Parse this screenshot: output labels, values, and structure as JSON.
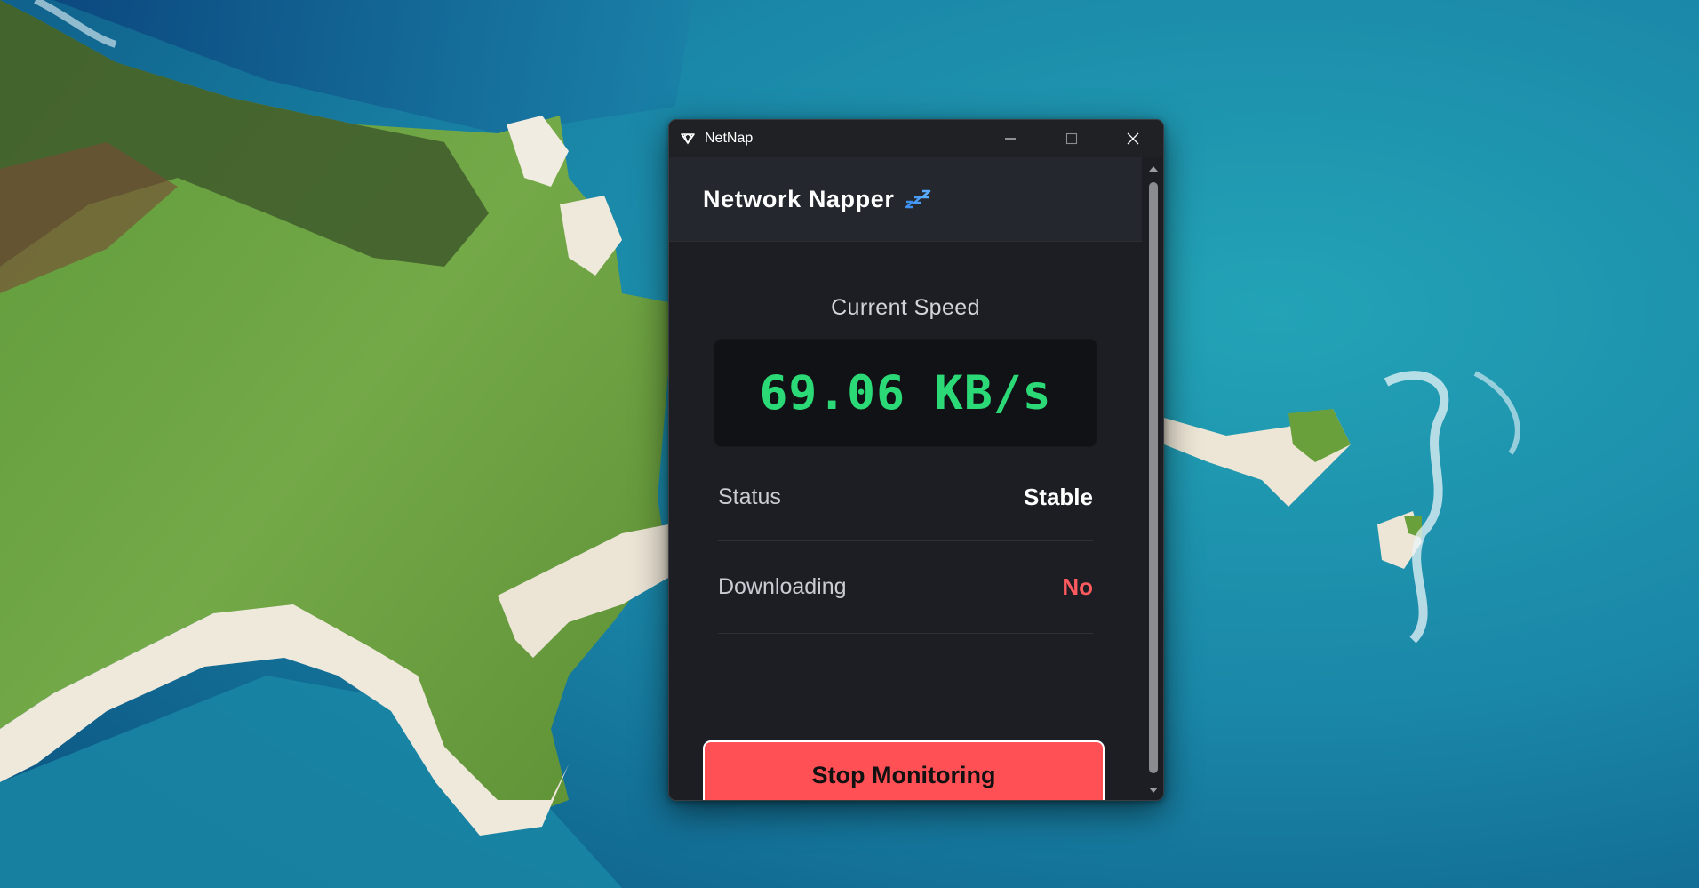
{
  "window": {
    "title": "NetNap"
  },
  "app": {
    "header_title": "Network Napper",
    "header_icon": "zzz-icon"
  },
  "speed": {
    "label": "Current Speed",
    "value": "69.06 KB/s"
  },
  "rows": [
    {
      "label": "Status",
      "value": "Stable",
      "value_color": "#ffffff"
    },
    {
      "label": "Downloading",
      "value": "No",
      "value_color": "#ff5a5f"
    }
  ],
  "action": {
    "stop_label": "Stop Monitoring",
    "color": "#ff5055"
  },
  "colors": {
    "speed_green": "#2bd977",
    "window_bg": "#1c1e23",
    "header_bg": "#24272d"
  }
}
